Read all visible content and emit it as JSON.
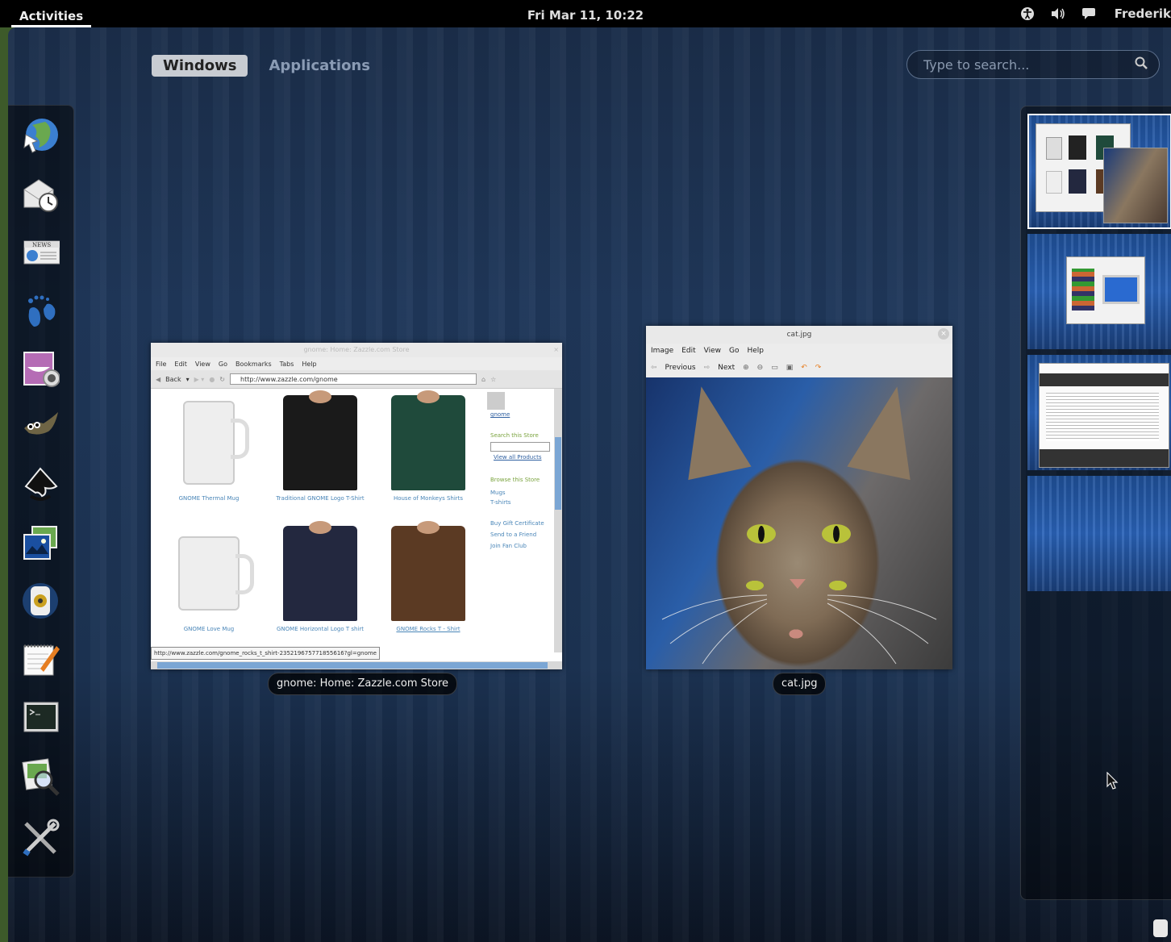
{
  "top_panel": {
    "activities_label": "Activities",
    "clock": "Fri Mar 11, 10:22",
    "user_name": "Frederik",
    "tray_icons": [
      "accessibility-icon",
      "volume-icon",
      "chat-icon"
    ]
  },
  "overview": {
    "tabs": [
      {
        "label": "Windows",
        "active": true
      },
      {
        "label": "Applications",
        "active": false
      }
    ],
    "search": {
      "placeholder": "Type to search...",
      "value": ""
    }
  },
  "dash": {
    "apps": [
      "web-browser-icon",
      "mail-clock-icon",
      "news-icon",
      "gnome-foot-icon",
      "cheese-icon",
      "gimp-icon",
      "inkscape-icon",
      "photos-icon",
      "audio-player-icon",
      "text-editor-icon",
      "terminal-icon",
      "image-viewer-icon",
      "system-tools-icon"
    ]
  },
  "windows": {
    "browser": {
      "caption": "gnome: Home: Zazzle.com Store",
      "title": "gnome: Home: Zazzle.com Store",
      "menu": [
        "File",
        "Edit",
        "View",
        "Go",
        "Bookmarks",
        "Tabs",
        "Help"
      ],
      "back_label": "Back",
      "url": "http://www.zazzle.com/gnome",
      "products": [
        {
          "label": "GNOME Thermal Mug"
        },
        {
          "label": "Traditional GNOME Logo T-Shirt"
        },
        {
          "label": "House of Monkeys Shirts"
        },
        {
          "label": "GNOME Love Mug"
        },
        {
          "label": "GNOME Horizontal Logo T shirt"
        },
        {
          "label": "GNOME Rocks T - Shirt"
        }
      ],
      "sidebar": {
        "user": "gnome",
        "search_heading": "Search this Store",
        "view_all": "View all Products",
        "browse_heading": "Browse this Store",
        "links": [
          "Mugs",
          "T-shirts",
          "Buy Gift Certificate",
          "Send to a Friend",
          "Join Fan Club"
        ]
      },
      "status_url": "http://www.zazzle.com/gnome_rocks_t_shirt-235219675771855616?gl=gnome"
    },
    "viewer": {
      "caption": "cat.jpg",
      "title": "cat.jpg",
      "menu": [
        "Image",
        "Edit",
        "View",
        "Go",
        "Help"
      ],
      "toolbar": {
        "previous": "Previous",
        "next": "Next"
      }
    }
  },
  "workspaces": [
    {
      "index": 1,
      "active": true
    },
    {
      "index": 2,
      "active": false
    },
    {
      "index": 3,
      "active": false
    },
    {
      "index": 4,
      "active": false
    }
  ]
}
